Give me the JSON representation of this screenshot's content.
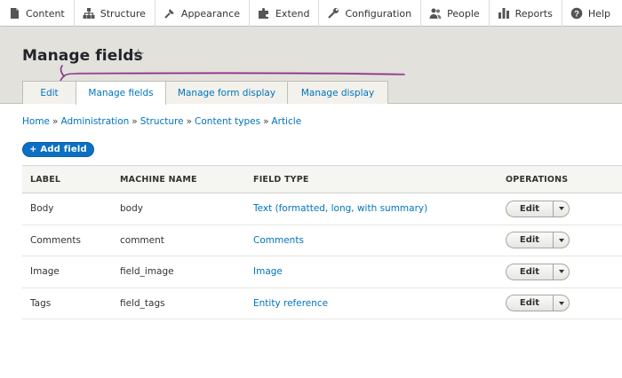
{
  "toolbar": {
    "items": [
      {
        "label": "Content",
        "icon": "content-icon"
      },
      {
        "label": "Structure",
        "icon": "structure-icon"
      },
      {
        "label": "Appearance",
        "icon": "appearance-icon"
      },
      {
        "label": "Extend",
        "icon": "extend-icon"
      },
      {
        "label": "Configuration",
        "icon": "configuration-icon"
      },
      {
        "label": "People",
        "icon": "people-icon"
      },
      {
        "label": "Reports",
        "icon": "reports-icon"
      },
      {
        "label": "Help",
        "icon": "help-icon"
      }
    ]
  },
  "header": {
    "title": "Manage fields",
    "star": "☆",
    "tabs": [
      {
        "label": "Edit",
        "active": false
      },
      {
        "label": "Manage fields",
        "active": true
      },
      {
        "label": "Manage form display",
        "active": false
      },
      {
        "label": "Manage display",
        "active": false
      }
    ]
  },
  "breadcrumb": [
    "Home",
    "Administration",
    "Structure",
    "Content types",
    "Article"
  ],
  "breadcrumb_separator": "»",
  "add_button": "+ Add field",
  "table": {
    "headers": [
      "LABEL",
      "MACHINE NAME",
      "FIELD TYPE",
      "OPERATIONS"
    ],
    "rows": [
      {
        "label": "Body",
        "machine_name": "body",
        "field_type": "Text (formatted, long, with summary)",
        "operation": "Edit"
      },
      {
        "label": "Comments",
        "machine_name": "comment",
        "field_type": "Comments",
        "operation": "Edit"
      },
      {
        "label": "Image",
        "machine_name": "field_image",
        "field_type": "Image",
        "operation": "Edit"
      },
      {
        "label": "Tags",
        "machine_name": "field_tags",
        "field_type": "Entity reference",
        "operation": "Edit"
      }
    ]
  },
  "colors": {
    "link": "#0074bd",
    "primary_button": "#0b70c3",
    "header_background": "#e2e1dc",
    "annotation": "#8a2f86"
  }
}
